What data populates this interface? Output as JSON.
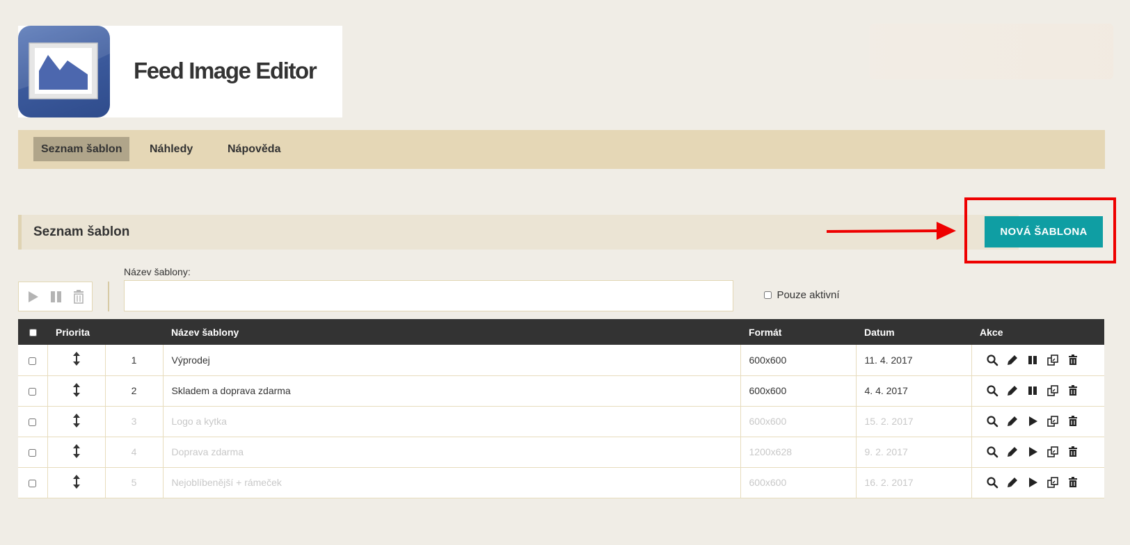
{
  "app": {
    "title": "Feed Image Editor"
  },
  "nav": {
    "items": [
      {
        "label": "Seznam šablon",
        "active": true
      },
      {
        "label": "Náhledy",
        "active": false
      },
      {
        "label": "Nápověda",
        "active": false
      }
    ]
  },
  "section": {
    "title": "Seznam šablon",
    "new_button": "NOVÁ ŠABLONA"
  },
  "filters": {
    "name_label": "Název šablony:",
    "name_value": "",
    "only_active_label": "Pouze aktivní",
    "only_active_checked": false
  },
  "table": {
    "columns": [
      "",
      "Priorita",
      "",
      "Název šablony",
      "Formát",
      "Datum",
      "Akce"
    ],
    "rows": [
      {
        "priority": "1",
        "name": "Výprodej",
        "format": "600x600",
        "date": "11. 4. 2017",
        "active": true
      },
      {
        "priority": "2",
        "name": "Skladem a doprava zdarma",
        "format": "600x600",
        "date": "4. 4. 2017",
        "active": true
      },
      {
        "priority": "3",
        "name": "Logo a kytka",
        "format": "600x600",
        "date": "15. 2. 2017",
        "active": false
      },
      {
        "priority": "4",
        "name": "Doprava zdarma",
        "format": "1200x628",
        "date": "9. 2. 2017",
        "active": false
      },
      {
        "priority": "5",
        "name": "Nejoblíbenější + rámeček",
        "format": "600x600",
        "date": "16. 2. 2017",
        "active": false
      }
    ]
  },
  "icons": {
    "logo": "image-landscape-icon",
    "bulk": [
      "play-icon",
      "pause-icon",
      "trash-icon"
    ],
    "row_sort": "vertical-arrows-icon",
    "row_actions_active": [
      "search-icon",
      "pencil-icon",
      "pause-icon",
      "copy-icon",
      "trash-icon"
    ],
    "row_actions_inactive": [
      "search-icon",
      "pencil-icon",
      "play-icon",
      "copy-icon",
      "trash-icon"
    ]
  },
  "colors": {
    "background": "#f0ede6",
    "nav": "#e5d7b6",
    "nav_active": "#b0a58a",
    "primary_button": "#0f9ea3",
    "table_header": "#333333",
    "annotation": "#ee0000"
  }
}
